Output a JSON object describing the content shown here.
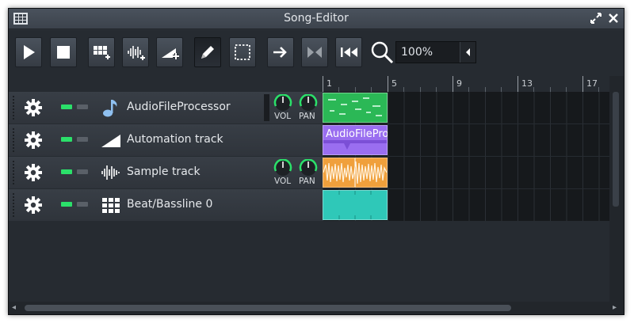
{
  "window": {
    "title": "Song-Editor"
  },
  "toolbar": {
    "buttons": [
      {
        "name": "play-button"
      },
      {
        "name": "stop-button"
      },
      {
        "name": "add-beat-bassline-button"
      },
      {
        "name": "add-sample-track-button"
      },
      {
        "name": "add-automation-track-button"
      },
      {
        "name": "draw-mode-button"
      },
      {
        "name": "select-mode-button"
      },
      {
        "name": "auto-scroll-button"
      },
      {
        "name": "loop-points-button"
      },
      {
        "name": "stop-behaviour-button"
      }
    ],
    "zoom_value": "100%"
  },
  "ruler": {
    "marks": [
      "1",
      "5",
      "9",
      "13",
      "17"
    ]
  },
  "tracks": [
    {
      "name": "AudioFileProcessor",
      "icon": "music-note-icon",
      "has_knobs": true,
      "vol_label": "VOL",
      "pan_label": "PAN",
      "clip_color": "#2bb856",
      "clip_text": ""
    },
    {
      "name": "Automation track",
      "icon": "automation-icon",
      "has_knobs": false,
      "clip_color": "#9a6ef0",
      "clip_text": "AudioFileProc"
    },
    {
      "name": "Sample track",
      "icon": "waveform-icon",
      "has_knobs": true,
      "vol_label": "VOL",
      "pan_label": "PAN",
      "clip_color": "#f0a03c",
      "clip_text": ""
    },
    {
      "name": "Beat/Bassline 0",
      "icon": "beat-grid-icon",
      "has_knobs": false,
      "clip_color": "#2fc8b8",
      "clip_text": ""
    }
  ],
  "colors": {
    "accent": "#2be06a",
    "background": "#2a2f36"
  }
}
